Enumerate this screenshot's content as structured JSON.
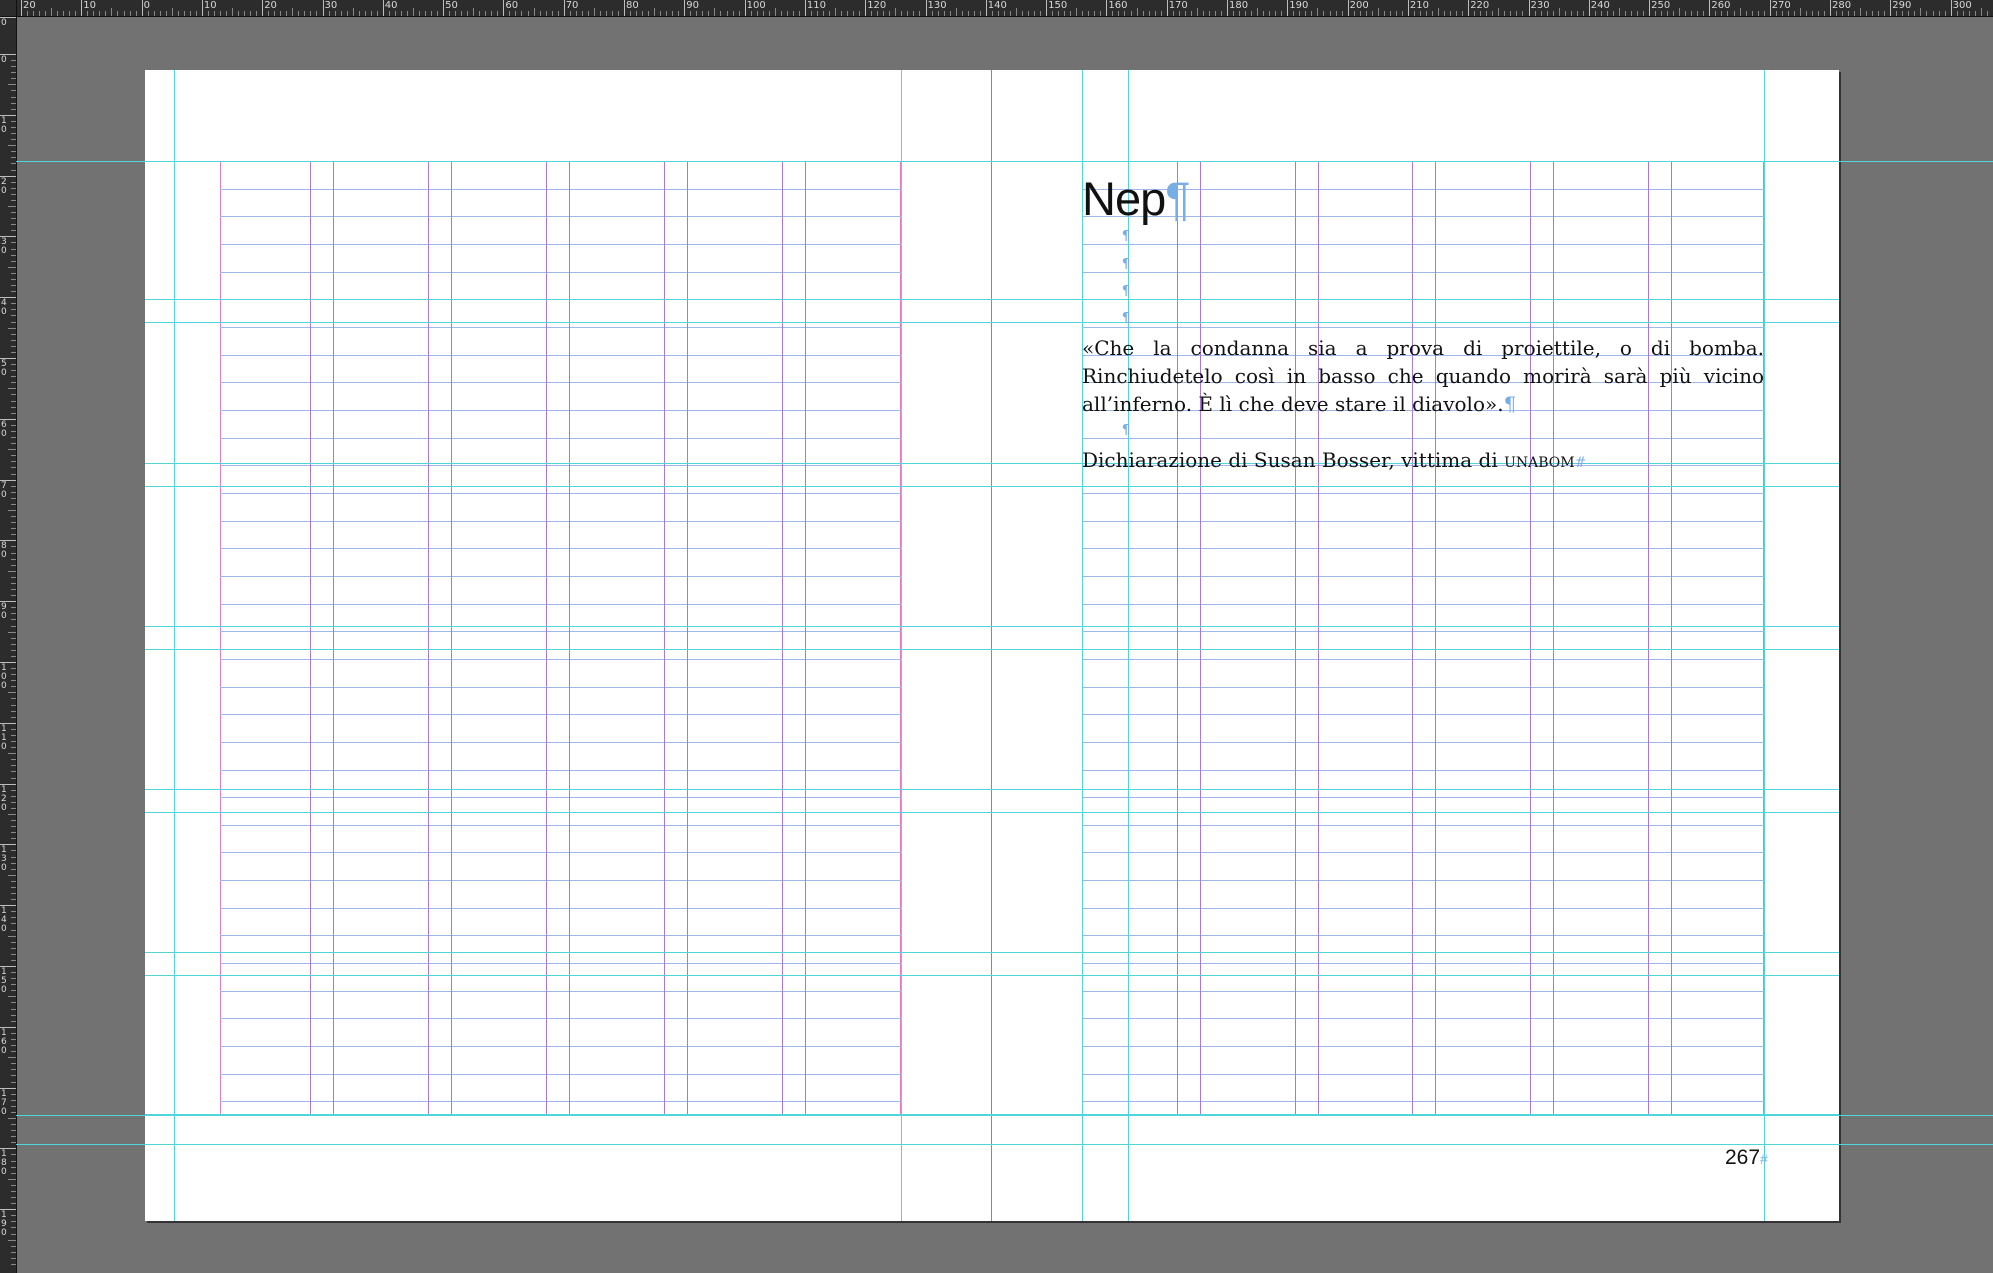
{
  "rulers": {
    "horizontal_labels": [
      "20",
      "10",
      "0",
      "10",
      "20",
      "30",
      "40",
      "50",
      "60",
      "70",
      "80",
      "90",
      "100",
      "110",
      "120",
      "130",
      "140",
      "150",
      "160",
      "170",
      "180",
      "190",
      "200",
      "210",
      "220",
      "230",
      "240",
      "250",
      "260",
      "270",
      "280",
      "290",
      "300"
    ],
    "vertical_labels": [
      "0",
      "0",
      "10",
      "20",
      "30",
      "40",
      "50",
      "60",
      "70",
      "80",
      "90",
      "100",
      "110",
      "120",
      "130",
      "140",
      "150",
      "160",
      "170",
      "180",
      "190"
    ]
  },
  "spread": {
    "right_page": {
      "chapter_title": "Nep",
      "pilcrow": "¶",
      "quote": "«Che la condanna sia a prova di proiettile, o di bomba. Rinchiudetelo così in basso che quando morirà sarà più vicino all’inferno. È lì che deve stare il diavolo».",
      "attribution_prefix": "Dichiarazione di Susan Bosser, vittima di ",
      "attribution_smallcaps": "Unabom",
      "end_mark": "#",
      "page_number": "267"
    }
  },
  "colors": {
    "pasteboard": "#727272",
    "ruler_bg": "#2c2c2c",
    "guide": "#4fd6dd",
    "baseline_grid": "#9fb8ea",
    "column_guide": "#a77ad6",
    "margin_guide": "#e47bc6",
    "hidden_char": "#78aee6"
  }
}
